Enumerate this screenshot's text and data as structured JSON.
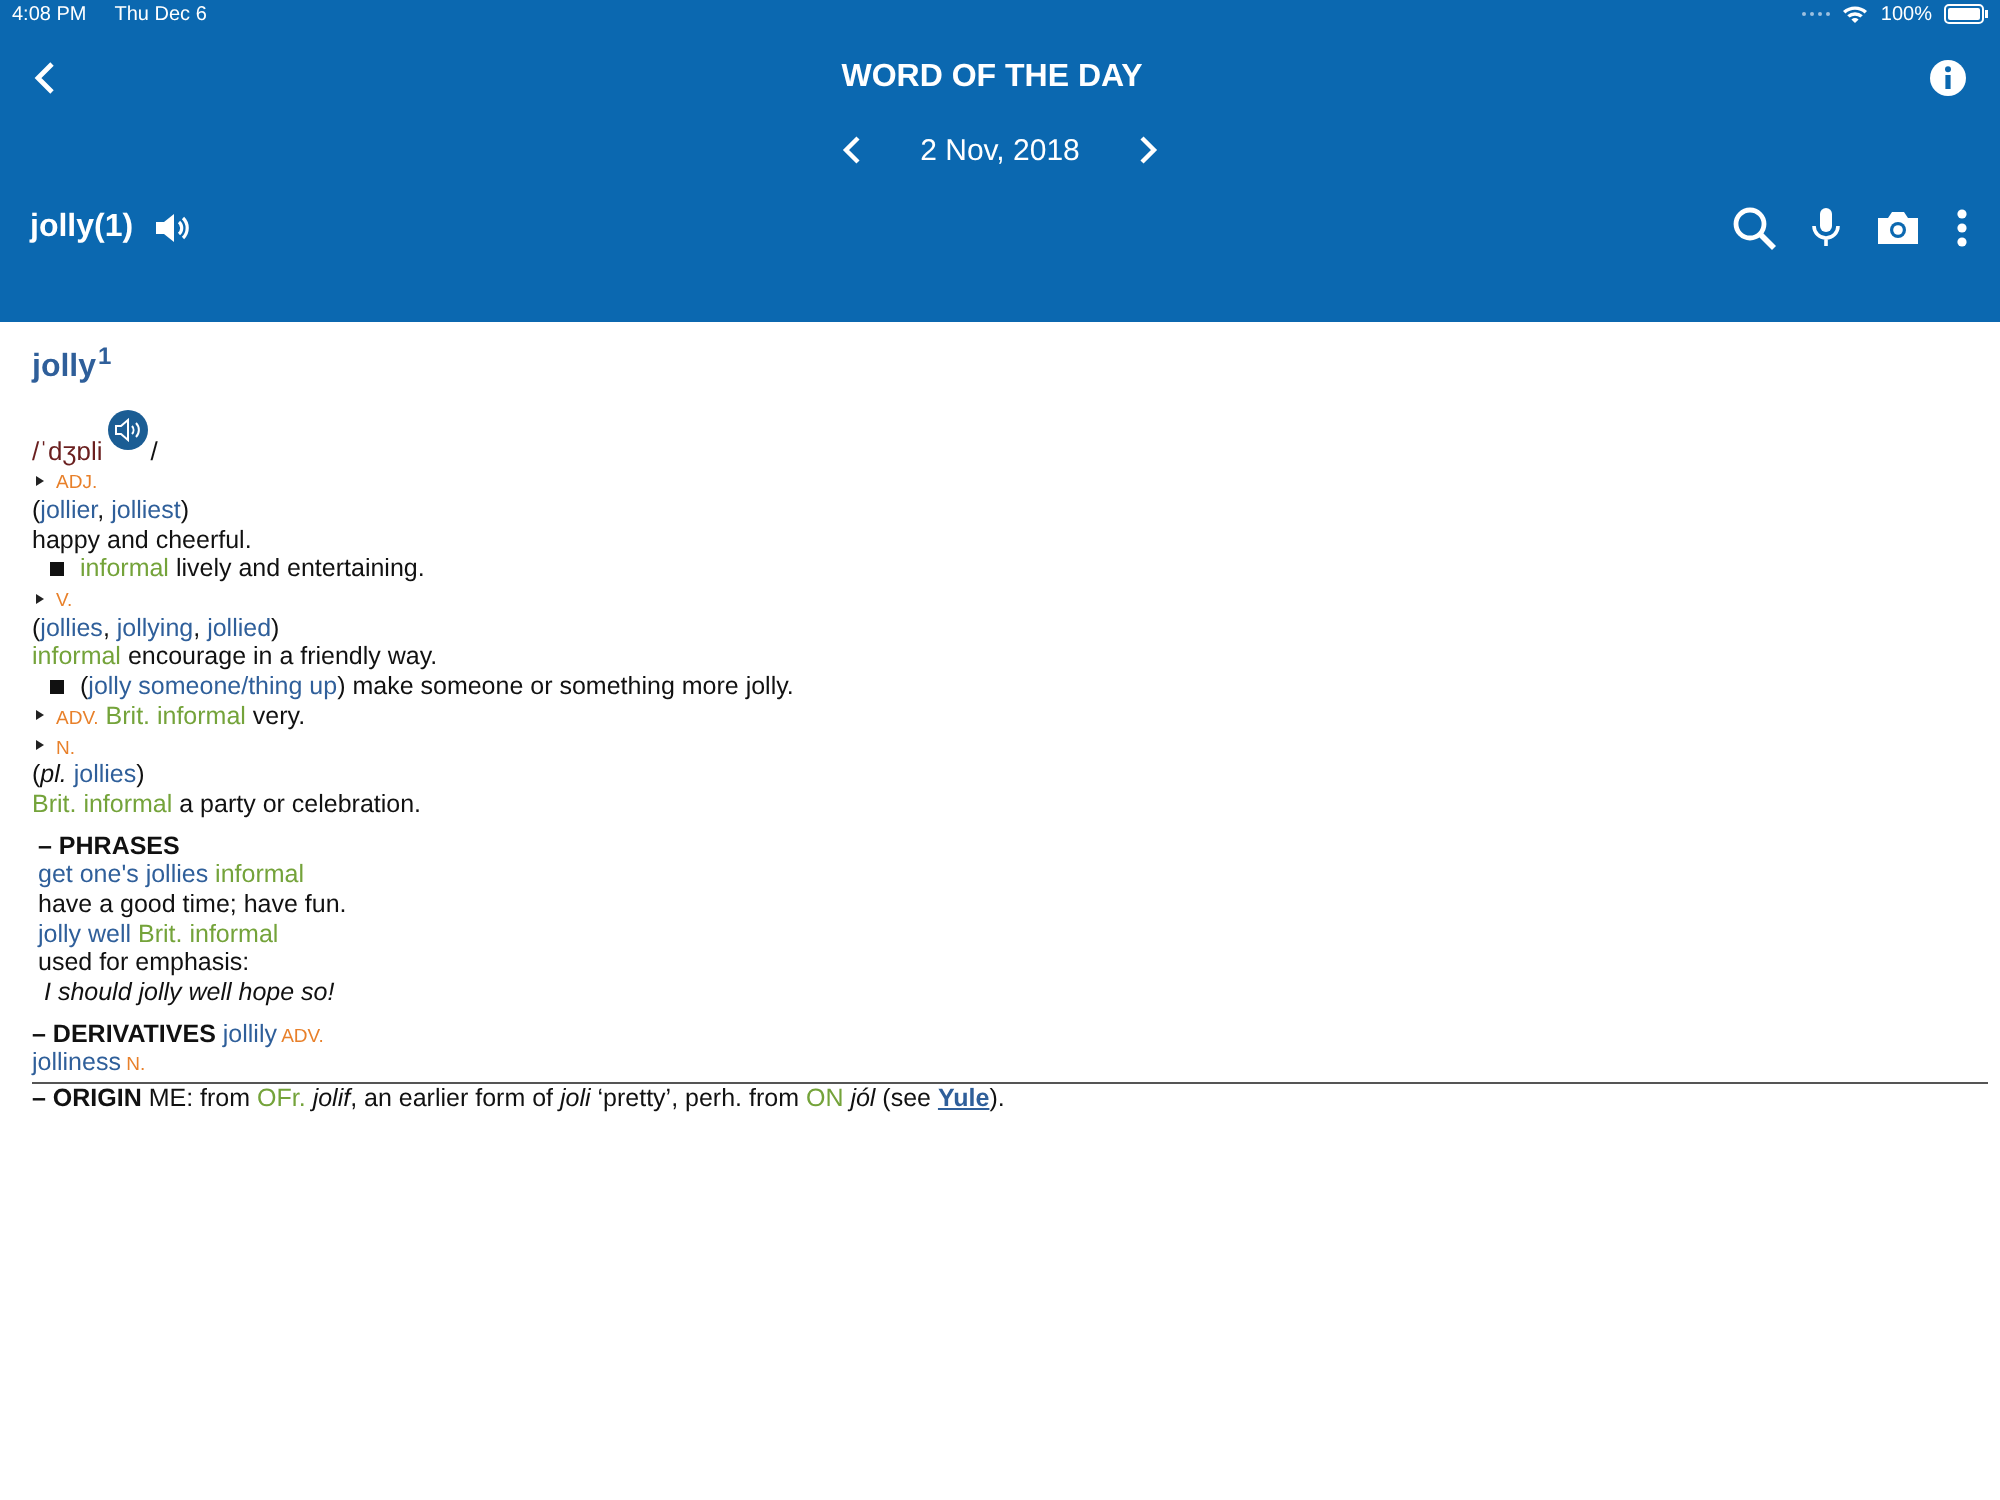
{
  "status_bar": {
    "time": "4:08 PM",
    "date": "Thu Dec 6",
    "battery": "100%"
  },
  "header": {
    "title": "WORD OF THE DAY",
    "date": "2 Nov, 2018",
    "word": "jolly(1)"
  },
  "entry": {
    "headword": "jolly",
    "homograph": "1",
    "pronunciation": "/ˈdʒɒli",
    "pronunciation_end": "/",
    "lines": [
      {
        "kind": "pos",
        "segs": [
          {
            "kind": "pos",
            "s": "ADJ."
          }
        ]
      },
      {
        "kind": "plain",
        "segs": [
          {
            "kind": "txt",
            "s": "("
          },
          {
            "kind": "w",
            "s": "jollier"
          },
          {
            "kind": "txt",
            "s": ", "
          },
          {
            "kind": "w",
            "s": "jolliest"
          },
          {
            "kind": "txt",
            "s": ")"
          }
        ]
      },
      {
        "kind": "plain",
        "segs": [
          {
            "kind": "txt",
            "s": "happy and cheerful."
          }
        ]
      },
      {
        "kind": "bullet",
        "segs": [
          {
            "kind": "lab",
            "s": "informal"
          },
          {
            "kind": "txt",
            "s": " lively and entertaining."
          }
        ]
      },
      {
        "kind": "pos",
        "segs": [
          {
            "kind": "pos",
            "s": "V."
          }
        ]
      },
      {
        "kind": "plain",
        "segs": [
          {
            "kind": "txt",
            "s": "("
          },
          {
            "kind": "w",
            "s": "jollies"
          },
          {
            "kind": "txt",
            "s": ", "
          },
          {
            "kind": "w",
            "s": "jollying"
          },
          {
            "kind": "txt",
            "s": ", "
          },
          {
            "kind": "w",
            "s": "jollied"
          },
          {
            "kind": "txt",
            "s": ")"
          }
        ]
      },
      {
        "kind": "plain",
        "segs": [
          {
            "kind": "lab",
            "s": "informal"
          },
          {
            "kind": "txt",
            "s": " encourage in a friendly way."
          }
        ]
      },
      {
        "kind": "bullet",
        "segs": [
          {
            "kind": "txt",
            "s": "("
          },
          {
            "kind": "w",
            "s": "jolly someone/thing up"
          },
          {
            "kind": "txt",
            "s": ") make someone or something more jolly."
          }
        ]
      },
      {
        "kind": "pos",
        "segs": [
          {
            "kind": "pos",
            "s": "ADV."
          },
          {
            "kind": "lab",
            "s": " Brit. informal"
          },
          {
            "kind": "txt",
            "s": " very."
          }
        ]
      },
      {
        "kind": "pos",
        "segs": [
          {
            "kind": "pos",
            "s": "N."
          }
        ]
      },
      {
        "kind": "plain",
        "segs": [
          {
            "kind": "txt",
            "s": "("
          },
          {
            "kind": "it",
            "s": "pl."
          },
          {
            "kind": "w",
            "s": " jollies"
          },
          {
            "kind": "txt",
            "s": ")"
          }
        ]
      },
      {
        "kind": "plain",
        "segs": [
          {
            "kind": "lab",
            "s": "Brit. informal"
          },
          {
            "kind": "txt",
            "s": " a party or celebration."
          }
        ]
      },
      {
        "kind": "section",
        "segs": [
          {
            "kind": "hd",
            "s": "– PHRASES"
          }
        ]
      },
      {
        "kind": "indent",
        "segs": [
          {
            "kind": "w",
            "s": "get one's jollies"
          },
          {
            "kind": "lab",
            "s": " informal"
          }
        ]
      },
      {
        "kind": "indent",
        "segs": [
          {
            "kind": "txt",
            "s": "have a good time; have fun."
          }
        ]
      },
      {
        "kind": "indent",
        "segs": [
          {
            "kind": "w",
            "s": "jolly well"
          },
          {
            "kind": "lab",
            "s": " Brit. informal"
          }
        ]
      },
      {
        "kind": "indent",
        "segs": [
          {
            "kind": "txt",
            "s": "used for emphasis:"
          }
        ]
      },
      {
        "kind": "example",
        "segs": [
          {
            "kind": "it",
            "s": "I should jolly well hope so!"
          }
        ]
      },
      {
        "kind": "section2",
        "segs": [
          {
            "kind": "hd",
            "s": "– DERIVATIVES"
          },
          {
            "kind": "w",
            "s": " jollily"
          },
          {
            "kind": "pos",
            "s": " ADV."
          }
        ]
      },
      {
        "kind": "plain",
        "segs": [
          {
            "kind": "w",
            "s": "jolliness"
          },
          {
            "kind": "pos",
            "s": " N."
          }
        ]
      },
      {
        "kind": "origin",
        "segs": [
          {
            "kind": "hd",
            "s": "– ORIGIN"
          },
          {
            "kind": "txt",
            "s": " ME: from "
          },
          {
            "kind": "lab",
            "s": "OFr."
          },
          {
            "kind": "it",
            "s": " jolif"
          },
          {
            "kind": "txt",
            "s": ", an earlier form of "
          },
          {
            "kind": "it",
            "s": "joli"
          },
          {
            "kind": "txt",
            "s": " ‘pretty’, perh. from "
          },
          {
            "kind": "lab",
            "s": "ON"
          },
          {
            "kind": "it",
            "s": " jól"
          },
          {
            "kind": "txt",
            "s": " (see "
          },
          {
            "kind": "link",
            "s": "Yule"
          },
          {
            "kind": "txt",
            "s": ")."
          }
        ]
      }
    ]
  }
}
